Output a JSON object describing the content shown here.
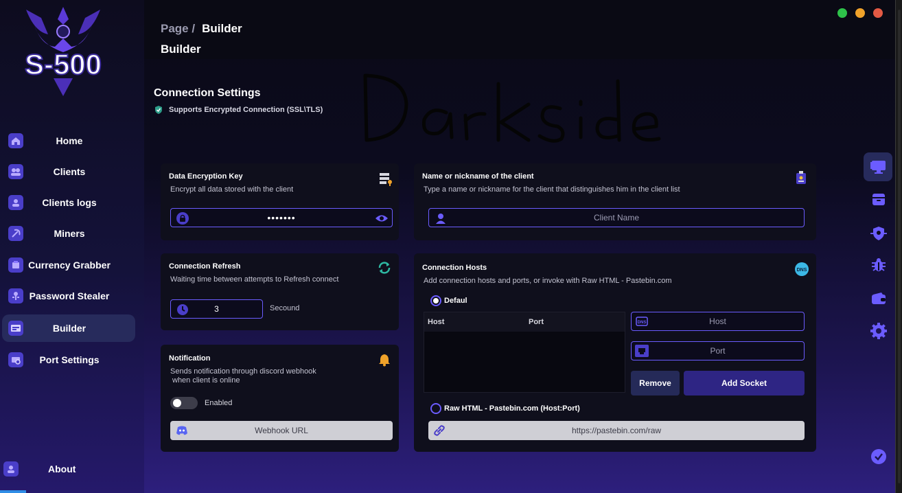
{
  "app": {
    "logo_text": "S-500",
    "window_controls": {
      "close_color": "#e35a44",
      "minimize_color": "#f0a22a",
      "maximize_color": "#2ec24a"
    }
  },
  "sidebar": {
    "items": [
      {
        "label": "Home",
        "icon": "home-icon"
      },
      {
        "label": "Clients",
        "icon": "users-icon"
      },
      {
        "label": "Clients logs",
        "icon": "user-log-icon"
      },
      {
        "label": "Miners",
        "icon": "pickaxe-icon"
      },
      {
        "label": "Currency Grabber",
        "icon": "wallet-grab-icon"
      },
      {
        "label": "Password Stealer",
        "icon": "key-icon"
      },
      {
        "label": "Builder",
        "icon": "builder-icon",
        "active": true
      },
      {
        "label": "Port Settings",
        "icon": "port-settings-icon"
      }
    ],
    "about_label": "About"
  },
  "header": {
    "breadcrumb_root": "Page /",
    "breadcrumb_current": "Builder",
    "title": "Builder"
  },
  "connection": {
    "title": "Connection Settings",
    "subtitle": "Supports Encrypted Connection (SSL\\TLS)"
  },
  "watermark": "DarkSide",
  "encryption_card": {
    "title": "Data Encryption Key",
    "description": "Encrypt all data stored with the client",
    "value": "•••••••"
  },
  "client_name_card": {
    "title": "Name or nickname of the client",
    "description": "Type a name or nickname for the client that distinguishes him in the client list",
    "placeholder": "Client Name"
  },
  "refresh_card": {
    "title": "Connection Refresh",
    "description": "Waiting time between attempts to Refresh connect",
    "value": "3",
    "unit": "Secound"
  },
  "notification_card": {
    "title": "Notification",
    "description_line1": "Sends notification through discord webhook",
    "description_line2": "when client is online",
    "toggle_label": "Enabled",
    "webhook_placeholder": "Webhook URL"
  },
  "hosts_card": {
    "title": "Connection Hosts",
    "description": "Add connection hosts and ports, or invoke with Raw HTML - Pastebin.com",
    "radio_default": "Defaul",
    "table_headers": [
      "Host",
      "Port"
    ],
    "host_placeholder": "Host",
    "port_placeholder": "Port",
    "remove_label": "Remove",
    "add_label": "Add Socket",
    "radio_raw": "Raw HTML - Pastebin.com (Host:Port)",
    "raw_url": "https://pastebin.com/raw"
  },
  "right_sidebar": {
    "icons": [
      "build-monitor-icon",
      "archive-icon",
      "shield-icon",
      "bug-icon",
      "wallet-icon",
      "settings-icon",
      "check-circle-icon"
    ]
  },
  "colors": {
    "accent": "#6b5cff",
    "button_primary": "#2e2584",
    "button_secondary": "#252a58",
    "card_bg": "#0f0f1c"
  }
}
